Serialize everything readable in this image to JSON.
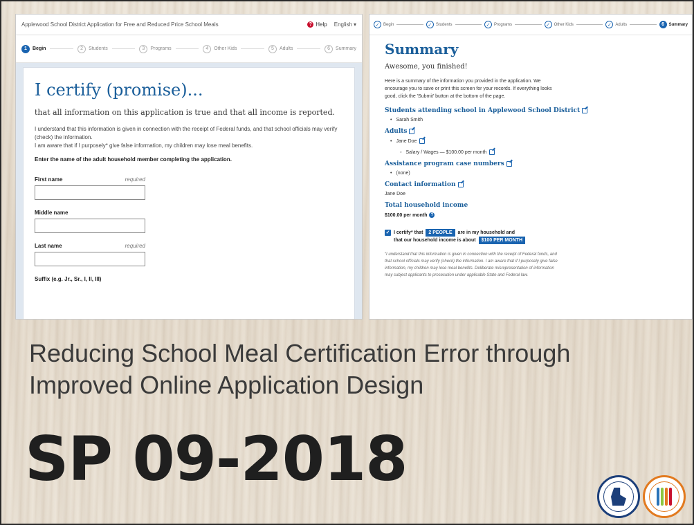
{
  "left_app": {
    "title": "Applewood School District Application for Free and Reduced Price School Meals",
    "help_label": "Help",
    "language": "English",
    "language_caret": "▾",
    "steps": [
      {
        "num": "1",
        "label": "Begin"
      },
      {
        "num": "2",
        "label": "Students"
      },
      {
        "num": "3",
        "label": "Programs"
      },
      {
        "num": "4",
        "label": "Other Kids"
      },
      {
        "num": "5",
        "label": "Adults"
      },
      {
        "num": "6",
        "label": "Summary"
      }
    ],
    "heading": "I certify (promise)...",
    "lead": "that all information on this application is true and that all income is reported.",
    "body_1": "I understand that this information is given in connection with the receipt of Federal funds, and that school officials may verify (check) the information.",
    "body_2": "I am aware that if I purposely* give false information, my children may lose meal benefits.",
    "instruction": "Enter the name of the adult household member completing the application.",
    "fields": {
      "first_name": {
        "label": "First name",
        "required": "required",
        "value": ""
      },
      "middle_name": {
        "label": "Middle name",
        "value": ""
      },
      "last_name": {
        "label": "Last name",
        "required": "required",
        "value": ""
      },
      "suffix": {
        "label": "Suffix (e.g. Jr., Sr., I, II, III)"
      }
    }
  },
  "right_app": {
    "steps": [
      "Begin",
      "Students",
      "Programs",
      "Other Kids",
      "Adults",
      "Summary"
    ],
    "active_step_num": "6",
    "check_glyph": "✓",
    "heading": "Summary",
    "lead": "Awesome, you finished!",
    "intro": "Here is a summary of the information you provided in the application. We encourage you to save or print this screen for your records. If everything looks good, click the 'Submit' button at the bottom of the page.",
    "students_heading": "Students attending school in Applewood School District",
    "students": [
      "Sarah Smith"
    ],
    "adults_heading": "Adults",
    "adults": [
      "Jane Doe"
    ],
    "adult_income": "Salary / Wages — $100.00 per month",
    "assistance_heading": "Assistance program case numbers",
    "assistance": [
      "(none)"
    ],
    "contact_heading": "Contact information",
    "contact": "Jane Doe",
    "income_heading": "Total household income",
    "income_value": "$100.00 per month",
    "certify_pre": "I certify* that",
    "people_pill": "2 PEOPLE",
    "certify_mid": "are in my household and",
    "certify_line2": "that our household income is about",
    "income_pill": "$100 PER MONTH",
    "disclaimer": "“I understand that this information is given in connection with the receipt of Federal funds, and that school officials may verify (check) the information. I am aware that if I purposely give false information, my children may lose meal benefits. Deliberate misrepresentation of information may subject applicants to prosecution under applicable State and Federal law."
  },
  "slide": {
    "title": "Reducing School Meal Certification Error through Improved Online Application Design",
    "code": "SP 09-2018"
  },
  "colors": {
    "primary_blue": "#1a64b0",
    "heading_blue": "#1a5e9a",
    "help_red": "#c8102e"
  }
}
